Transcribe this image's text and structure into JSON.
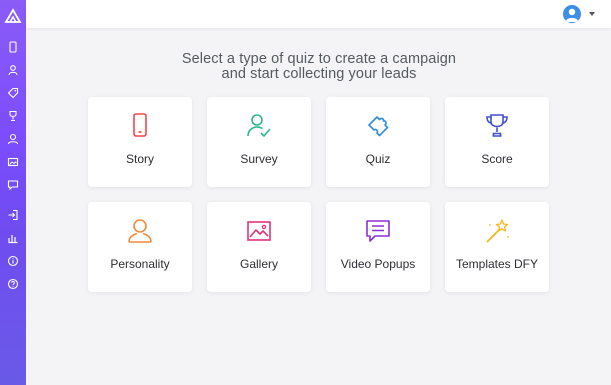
{
  "header": {
    "title_line1": "Select a type of quiz to create a campaign",
    "title_line2": "and start collecting your leads"
  },
  "sidebar": {
    "items": [
      {
        "icon": "phone-icon"
      },
      {
        "icon": "user-icon"
      },
      {
        "icon": "tag-icon"
      },
      {
        "icon": "trophy-icon"
      },
      {
        "icon": "person-icon"
      },
      {
        "icon": "image-icon"
      },
      {
        "icon": "chat-icon"
      },
      {
        "icon": "login-icon"
      },
      {
        "icon": "bar-chart-icon"
      },
      {
        "icon": "info-icon"
      },
      {
        "icon": "help-icon"
      }
    ]
  },
  "quiz_types": [
    {
      "label": "Story",
      "icon": "phone-icon",
      "color": "#f2464b"
    },
    {
      "label": "Survey",
      "icon": "user-check-icon",
      "color": "#2fb58a"
    },
    {
      "label": "Quiz",
      "icon": "puzzle-icon",
      "color": "#2a8de0"
    },
    {
      "label": "Score",
      "icon": "trophy-icon",
      "color": "#3f51c9"
    },
    {
      "label": "Personality",
      "icon": "person-icon",
      "color": "#f28b3c"
    },
    {
      "label": "Gallery",
      "icon": "image-icon",
      "color": "#e0357a"
    },
    {
      "label": "Video Popups",
      "icon": "chat-icon",
      "color": "#8e2fd2"
    },
    {
      "label": "Templates DFY",
      "icon": "magic-wand-icon",
      "color": "#f2b81b"
    }
  ]
}
